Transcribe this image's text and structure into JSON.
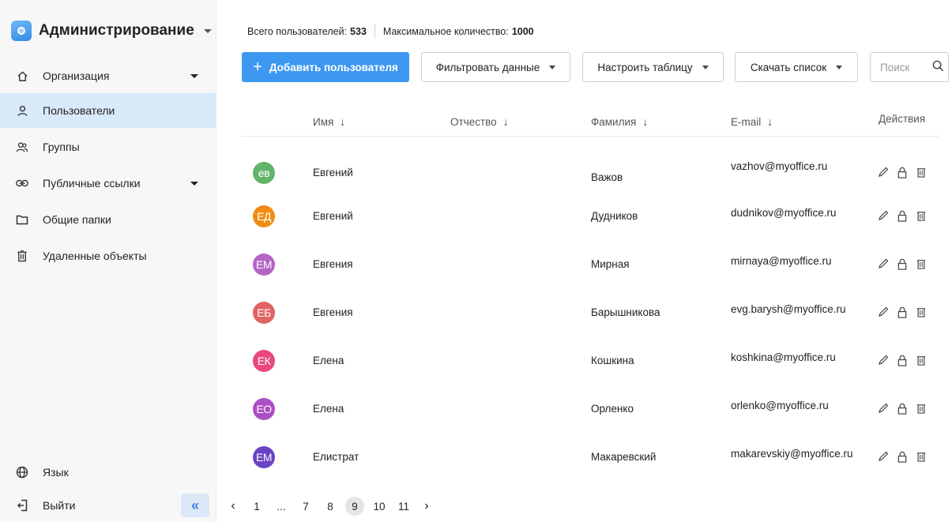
{
  "sidebar": {
    "title": "Администрирование",
    "items": [
      {
        "label": "Организация",
        "icon": "home-icon",
        "caret": true
      },
      {
        "label": "Пользователи",
        "icon": "user-icon",
        "active": true
      },
      {
        "label": "Группы",
        "icon": "group-icon"
      },
      {
        "label": "Публичные ссылки",
        "icon": "link-icon",
        "caret": true
      },
      {
        "label": "Общие папки",
        "icon": "folder-icon"
      },
      {
        "label": "Удаленные объекты",
        "icon": "trash-icon"
      }
    ],
    "bottom": [
      {
        "label": "Язык",
        "icon": "globe-icon"
      },
      {
        "label": "Выйти",
        "icon": "logout-icon"
      }
    ],
    "collapse_label": "«"
  },
  "header": {
    "total_label": "Всего пользователей:",
    "total_value": "533",
    "max_label": "Максимальное количество:",
    "max_value": "1000"
  },
  "toolbar": {
    "add_plus": "+",
    "add_label": "Добавить пользователя",
    "filter_label": "Фильтровать данные",
    "configure_label": "Настроить таблицу",
    "download_label": "Скачать список",
    "search_placeholder": "Поиск"
  },
  "table": {
    "columns": {
      "first_name": "Имя",
      "patronymic": "Отчество",
      "last_name": "Фамилия",
      "email": "E-mail",
      "actions": "Действия"
    },
    "sort_arrow": "↓",
    "rows": [
      {
        "initials": "ев",
        "color": "#62b46a",
        "first_name": "Евгений",
        "patronymic": "",
        "last_name": "Важов",
        "email": "vazhov@myoffice.ru"
      },
      {
        "initials": "ЕД",
        "color": "#f08c14",
        "first_name": "Евгений",
        "patronymic": "",
        "last_name": "Дудников",
        "email": "dudnikov@myoffice.ru"
      },
      {
        "initials": "ЕМ",
        "color": "#b565c4",
        "first_name": "Евгения",
        "patronymic": "",
        "last_name": "Мирная",
        "email": "mirnaya@myoffice.ru"
      },
      {
        "initials": "ЕБ",
        "color": "#e06464",
        "first_name": "Евгения",
        "patronymic": "",
        "last_name": "Барышникова",
        "email": "evg.barysh@myoffice.ru"
      },
      {
        "initials": "ЕК",
        "color": "#e9477f",
        "first_name": "Елена",
        "patronymic": "",
        "last_name": "Кошкина",
        "email": "koshkina@myoffice.ru"
      },
      {
        "initials": "ЕО",
        "color": "#ab4fc4",
        "first_name": "Елена",
        "patronymic": "",
        "last_name": "Орленко",
        "email": "orlenko@myoffice.ru"
      },
      {
        "initials": "ЕМ",
        "color": "#6a43c2",
        "first_name": "Елистрат",
        "patronymic": "",
        "last_name": "Макаревский",
        "email": "makarevskiy@myoffice.ru"
      }
    ]
  },
  "pagination": {
    "prev": "‹",
    "next": "›",
    "pages": [
      "1",
      "...",
      "7",
      "8",
      "9",
      "10",
      "11"
    ],
    "current": "9"
  },
  "colors": {
    "accent": "#3c98f0",
    "active_nav": "#d8e9fa",
    "sidebar_bg": "#f7f7f7"
  }
}
